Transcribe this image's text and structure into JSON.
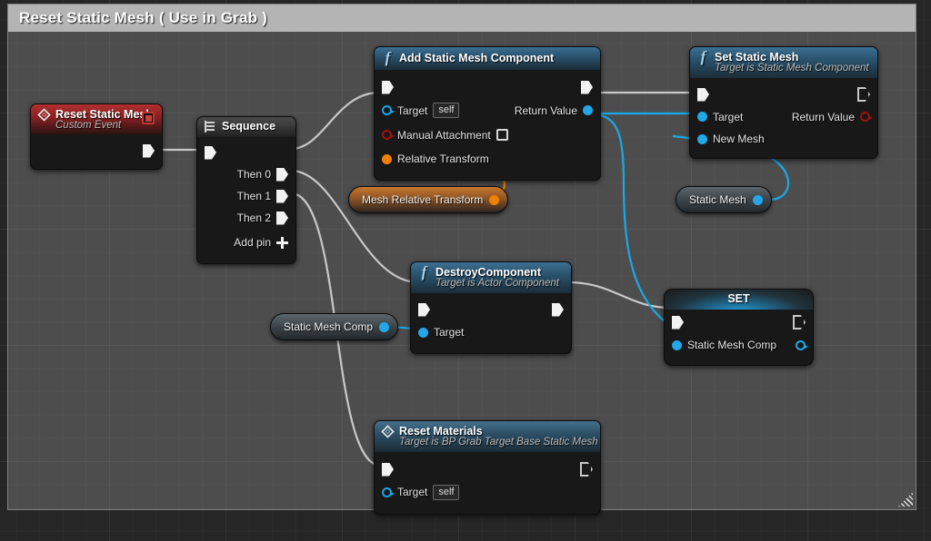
{
  "comment": {
    "title": "Reset Static Mesh ( Use in Grab )",
    "resize_grip": "resize-grip"
  },
  "colors": {
    "exec_wire": "#c8c8c8",
    "object_wire": "#19a9e8",
    "struct_wire": "#f08000",
    "event_header": "#b03030",
    "function_header": "#2b5672",
    "set_header_glow": "#2fa8e0"
  },
  "nodes": {
    "reset_static_mesh_event": {
      "title": "Reset Static Mesh",
      "subtitle": "Custom Event",
      "icon": "event-diamond-icon",
      "delegate_pin": "delegate-output-pin",
      "exec_out": ""
    },
    "sequence": {
      "title": "Sequence",
      "icon": "sequence-icon",
      "outputs": [
        {
          "label": "Then 0"
        },
        {
          "label": "Then 1"
        },
        {
          "label": "Then 2"
        }
      ],
      "add_pin": "Add pin"
    },
    "add_static_mesh_component": {
      "title": "Add Static Mesh Component",
      "icon": "function-f-icon",
      "inputs": [
        {
          "label": "Target",
          "value": "self",
          "pin": "object"
        },
        {
          "label": "Manual Attachment",
          "value": "",
          "pin": "bool"
        },
        {
          "label": "Relative Transform",
          "value": "",
          "pin": "struct"
        }
      ],
      "outputs": [
        {
          "label": "Return Value",
          "pin": "object"
        }
      ]
    },
    "set_static_mesh": {
      "title": "Set Static Mesh",
      "subtitle": "Target is Static Mesh Component",
      "icon": "function-f-icon",
      "inputs": [
        {
          "label": "Target",
          "pin": "object"
        },
        {
          "label": "New Mesh",
          "pin": "object"
        }
      ],
      "outputs": [
        {
          "label": "Return Value",
          "pin": "bool"
        }
      ]
    },
    "destroy_component": {
      "title": "DestroyComponent",
      "subtitle": "Target is Actor Component",
      "icon": "function-f-icon",
      "inputs": [
        {
          "label": "Target",
          "pin": "object"
        }
      ]
    },
    "set_variable": {
      "title": "SET",
      "inputs": [
        {
          "label": "Static Mesh Comp",
          "pin": "object"
        }
      ]
    },
    "reset_materials": {
      "title": "Reset Materials",
      "subtitle": "Target is BP Grab Target Base Static Mesh",
      "icon": "event-diamond-icon",
      "inputs": [
        {
          "label": "Target",
          "value": "self",
          "pin": "object"
        }
      ]
    }
  },
  "variables": {
    "mesh_relative_transform": {
      "label": "Mesh Relative Transform",
      "pin": "struct"
    },
    "static_mesh_comp": {
      "label": "Static Mesh Comp",
      "pin": "object"
    },
    "static_mesh": {
      "label": "Static Mesh",
      "pin": "object"
    }
  }
}
